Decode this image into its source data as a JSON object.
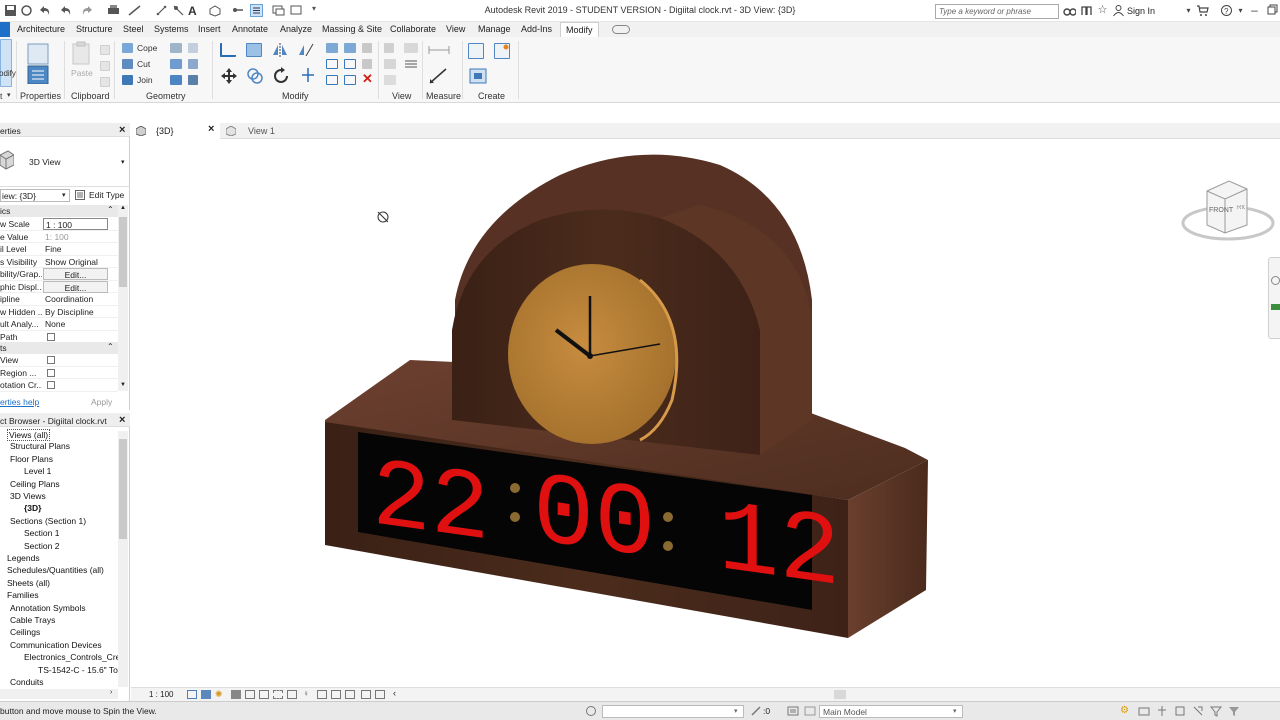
{
  "window": {
    "title": "Autodesk Revit 2019 - STUDENT VERSION - Digiital clock.rvt - 3D View: {3D}",
    "search_placeholder": "Type a keyword or phrase",
    "sign_in": "Sign In"
  },
  "ribbon_tabs": [
    "Architecture",
    "Structure",
    "Steel",
    "Systems",
    "Insert",
    "Annotate",
    "Analyze",
    "Massing & Site",
    "Collaborate",
    "View",
    "Manage",
    "Add-Ins",
    "Modify"
  ],
  "ribbon": {
    "modify_label": "odify",
    "select_label": "t",
    "properties_label": "Properties",
    "clipboard": {
      "label": "Clipboard",
      "paste": "Paste"
    },
    "geometry": {
      "label": "Geometry",
      "cope": "Cope",
      "cut": "Cut",
      "join": "Join"
    },
    "modify_group": "Modify",
    "view_group": "View",
    "measure_group": "Measure",
    "create_group": "Create"
  },
  "properties": {
    "title": "erties",
    "type_name": "3D View",
    "instance_selector": "iew: {3D}",
    "edit_type": "Edit Type",
    "group_graphics": "ics",
    "rows": [
      {
        "key": "w Scale",
        "value": "1 : 100"
      },
      {
        "key": "e Value",
        "value": "1:  100"
      },
      {
        "key": "il Level",
        "value": "Fine"
      },
      {
        "key": "s Visibility",
        "value": "Show Original"
      },
      {
        "key": "bility/Grap...",
        "value": "Edit..."
      },
      {
        "key": "phic Displ...",
        "value": "Edit..."
      },
      {
        "key": "ipline",
        "value": "Coordination"
      },
      {
        "key": "w Hidden ...",
        "value": "By Discipline"
      },
      {
        "key": "ult Analy...",
        "value": "None"
      },
      {
        "key": "Path",
        "value": ""
      }
    ],
    "group_extents": "ts",
    "extent_rows": [
      "View",
      "Region ...",
      "otation Cr..."
    ],
    "help_link": "erties help",
    "apply": "Apply"
  },
  "browser": {
    "title": "ct Browser - Digiital clock.rvt",
    "items": [
      {
        "label": "Views (all)",
        "level": 0
      },
      {
        "label": "Structural Plans",
        "level": 1
      },
      {
        "label": "Floor Plans",
        "level": 1
      },
      {
        "label": "Level 1",
        "level": 2
      },
      {
        "label": "Ceiling Plans",
        "level": 1
      },
      {
        "label": "3D Views",
        "level": 1
      },
      {
        "label": "{3D}",
        "level": 2
      },
      {
        "label": "Sections (Section 1)",
        "level": 1
      },
      {
        "label": "Section 1",
        "level": 2
      },
      {
        "label": "Section 2",
        "level": 2
      },
      {
        "label": "Legends",
        "level": 0
      },
      {
        "label": "Schedules/Quantities (all)",
        "level": 0
      },
      {
        "label": "Sheets (all)",
        "level": 0
      },
      {
        "label": "Families",
        "level": 0
      },
      {
        "label": "Annotation Symbols",
        "level": 1
      },
      {
        "label": "Cable Trays",
        "level": 1
      },
      {
        "label": "Ceilings",
        "level": 1
      },
      {
        "label": "Communication Devices",
        "level": 1
      },
      {
        "label": "Electronics_Controls_Cres",
        "level": 2
      },
      {
        "label": "TS-1542-C - 15.6\" To",
        "level": 3
      },
      {
        "label": "Conduits",
        "level": 1
      }
    ]
  },
  "view_tabs": [
    {
      "label": "{3D}",
      "active": true
    },
    {
      "label": "View 1",
      "active": false
    }
  ],
  "clock_display": {
    "hours": "22",
    "minutes": "00",
    "seconds": "12"
  },
  "viewcube": {
    "front": "FRONT",
    "right": "RIGHT"
  },
  "view_control": {
    "scale": "1 : 100"
  },
  "status": {
    "message": "button and move mouse to Spin the View.",
    "coord": ":0",
    "model": "Main Model"
  },
  "colors": {
    "wood": "#4a2c1c",
    "clock_face": "#c0873a",
    "digits": "#e01010",
    "accent": "#1e6fc7"
  }
}
